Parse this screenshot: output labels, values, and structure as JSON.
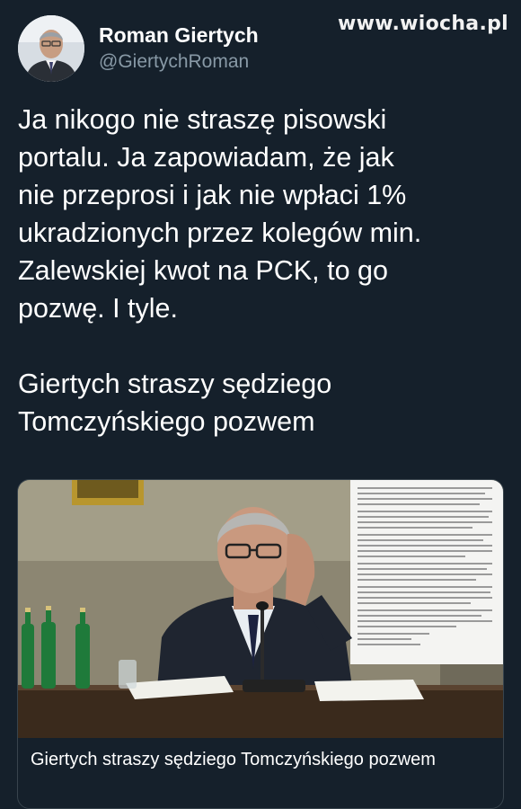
{
  "watermark": {
    "text": "www.wiocha.pl"
  },
  "author": {
    "display_name": "Roman Giertych",
    "handle": "@GiertychRoman"
  },
  "tweet": {
    "text": "Ja nikogo nie straszę pisowski\nportalu. Ja zapowiadam, że jak\nnie przeprosi i jak nie wpłaci 1%\nukradzionych przez kolegów min.\nZalewskiej kwot na PCK, to go\npozwę. I tyle.\n\nGiertych straszy sędziego\nTomczyńskiego pozwem"
  },
  "link_card": {
    "title": "Giertych straszy sędziego Tomczyńskiego pozwem"
  },
  "colors": {
    "background": "#15202b",
    "secondary_text": "#8899a6",
    "card_border": "#38444d"
  }
}
